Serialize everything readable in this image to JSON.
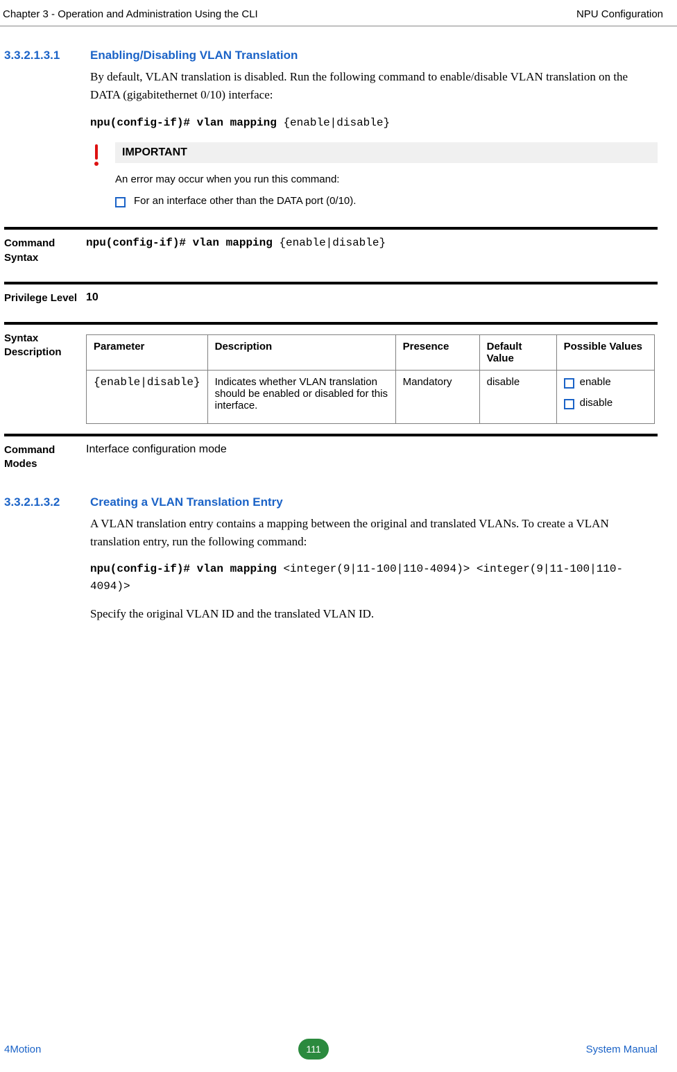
{
  "header": {
    "left": "Chapter 3 - Operation and Administration Using the CLI",
    "right": "NPU Configuration"
  },
  "sections": [
    {
      "num": "3.3.2.1.3.1",
      "title": "Enabling/Disabling VLAN Translation",
      "paras": [
        "By default, VLAN translation is disabled. Run the following command to enable/disable VLAN translation on the DATA (gigabitethernet 0/10) interface:"
      ],
      "cmd_bold": "npu(config-if)# vlan mapping ",
      "cmd_rest": "{enable|disable}"
    },
    {
      "num": "3.3.2.1.3.2",
      "title": "Creating a VLAN Translation Entry",
      "paras": [
        "A VLAN translation entry contains a mapping between the original and translated VLANs. To create a VLAN translation entry, run the following command:"
      ],
      "cmd_bold": "npu(config-if)# vlan mapping ",
      "cmd_rest": "<integer(9|11-100|110-4094)> <integer(9|11-100|110-4094)>",
      "after": "Specify the original VLAN ID and the translated VLAN ID."
    }
  ],
  "important": {
    "heading": "IMPORTANT",
    "text": "An error may occur when you run this command:",
    "bullets": [
      "For an interface other than the DATA port (0/10)."
    ]
  },
  "rows": {
    "command_syntax_label": "Command Syntax",
    "command_syntax_bold": "npu(config-if)# vlan mapping ",
    "command_syntax_rest": "{enable|disable}",
    "privilege_label": "Privilege Level",
    "privilege_value": "10",
    "syntax_label": "Syntax Description",
    "modes_label": "Command Modes",
    "modes_value": "Interface configuration mode"
  },
  "syntax_table": {
    "headers": [
      "Parameter",
      "Description",
      "Presence",
      "Default Value",
      "Possible Values"
    ],
    "row": {
      "param": "{enable|disable}",
      "desc": "Indicates whether VLAN translation should be enabled or disabled for this interface.",
      "presence": "Mandatory",
      "default": "disable",
      "possible": [
        "enable",
        "disable"
      ]
    }
  },
  "footer": {
    "left": "4Motion",
    "page": "111",
    "right": "System Manual"
  },
  "icons": {
    "important": "i"
  }
}
